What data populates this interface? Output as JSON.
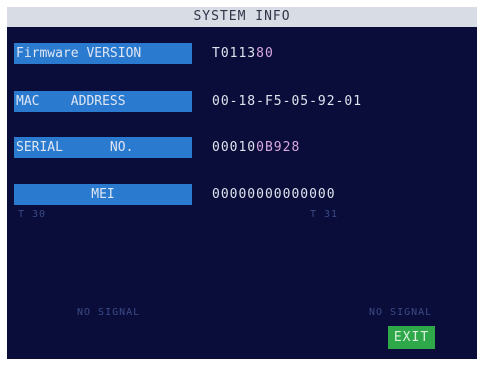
{
  "title": "SYSTEM INFO",
  "rows": [
    {
      "label": "Firmware VERSION",
      "value_main": "T0113",
      "value_accent": "80"
    },
    {
      "label": "MAC    ADDRESS",
      "value_main": "00-18-F5-05-92-01",
      "value_accent": ""
    },
    {
      "label": "SERIAL      NO.",
      "value_main": "00010",
      "value_accent": "0B928"
    },
    {
      "label": "MEI",
      "value_main": "00000000000000",
      "value_accent": ""
    }
  ],
  "ghosts": {
    "ch_left": "T 30",
    "ch_right": "T 31",
    "no_signal_left": "NO SIGNAL",
    "no_signal_right": "NO SIGNAL"
  },
  "exit_label": "EXIT",
  "colors": {
    "background": "#0a0d3a",
    "label_bg": "#2a7ad0",
    "title_bg": "#d8dce4",
    "exit_bg": "#2fa84a"
  }
}
